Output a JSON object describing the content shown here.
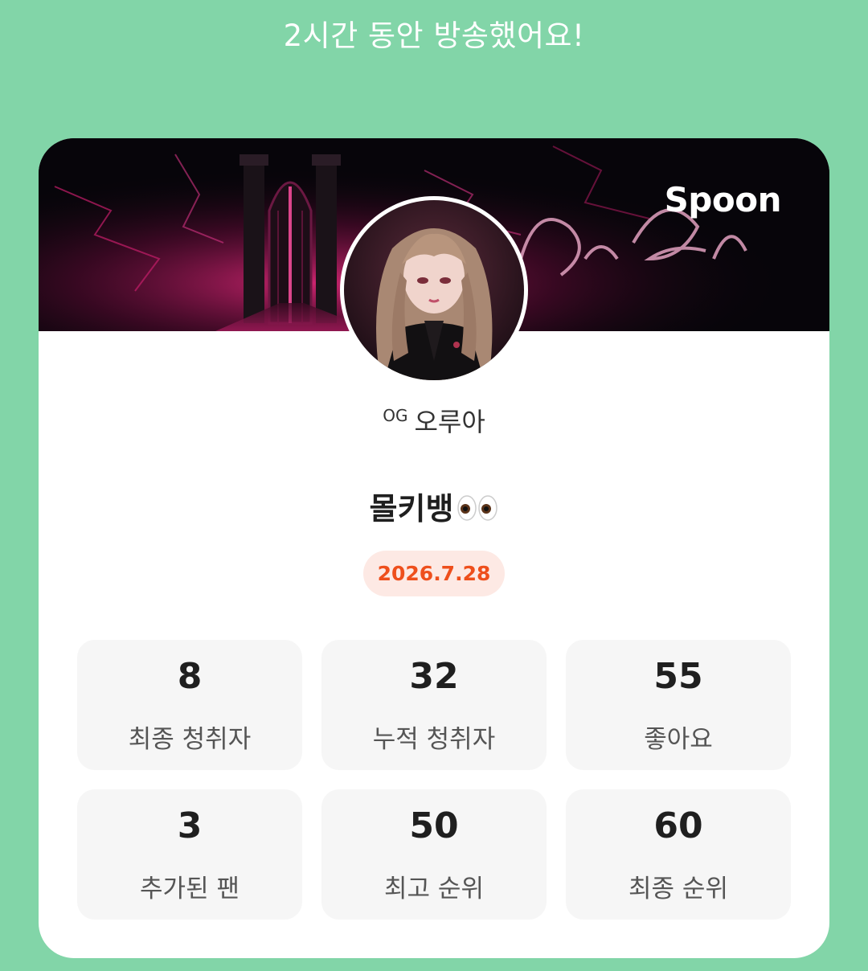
{
  "header": {
    "headline": "2시간 동안 방송했어요!"
  },
  "card": {
    "brand": "Spoon",
    "user": {
      "prefix": "OG",
      "name": "오루아"
    },
    "broadcast_title": "몰키뱅",
    "date": "2026.7.28",
    "stats": [
      {
        "value": "8",
        "label": "최종 청취자"
      },
      {
        "value": "32",
        "label": "누적 청취자"
      },
      {
        "value": "55",
        "label": "좋아요"
      },
      {
        "value": "3",
        "label": "추가된 팬"
      },
      {
        "value": "50",
        "label": "최고 순위"
      },
      {
        "value": "60",
        "label": "최종 순위"
      }
    ]
  },
  "colors": {
    "background": "#82d5a8",
    "accent": "#ee4f1c",
    "date_badge_bg": "#fde9e4"
  },
  "icons": [
    "eyes-emoji-icon"
  ]
}
